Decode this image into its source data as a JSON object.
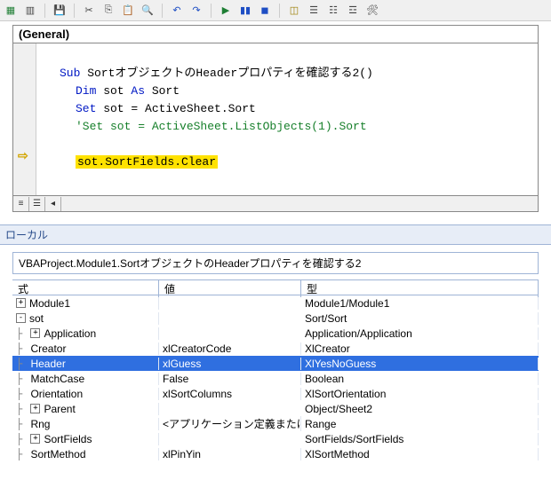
{
  "toolbar": {
    "icons": [
      "xls",
      "sheet",
      "save",
      "cut",
      "copy",
      "paste",
      "find",
      "undo",
      "redo",
      "run",
      "pause",
      "stop",
      "design",
      "proj",
      "props",
      "obj",
      "toolbox",
      "bookmark",
      "help"
    ]
  },
  "code": {
    "dropdown": "(General)",
    "sub_kw": "Sub",
    "sub_name": " SortオブジェクトのHeaderプロパティを確認する2()",
    "dim_kw": "Dim",
    "dim_rest": " sot ",
    "as_kw": "As",
    "dim_type": " Sort",
    "set_kw": "Set",
    "set_rest": " sot = ActiveSheet.Sort",
    "comment": "'Set sot = ActiveSheet.ListObjects(1).Sort",
    "exec_line": "sot.SortFields.Clear"
  },
  "locals": {
    "title": "ローカル",
    "context": "VBAProject.Module1.SortオブジェクトのHeaderプロパティを確認する2",
    "headers": {
      "expr": "式",
      "value": "値",
      "type": "型"
    },
    "rows": [
      {
        "depth": 0,
        "box": "+",
        "name": "Module1",
        "value": "",
        "type": "Module1/Module1",
        "sel": false
      },
      {
        "depth": 0,
        "box": "-",
        "name": "sot",
        "value": "",
        "type": "Sort/Sort",
        "sel": false
      },
      {
        "depth": 1,
        "box": "+",
        "name": "Application",
        "value": "",
        "type": "Application/Application",
        "sel": false
      },
      {
        "depth": 1,
        "box": "",
        "name": "Creator",
        "value": "xlCreatorCode",
        "type": "XlCreator",
        "sel": false
      },
      {
        "depth": 1,
        "box": "",
        "name": "Header",
        "value": "xlGuess",
        "type": "XlYesNoGuess",
        "sel": true
      },
      {
        "depth": 1,
        "box": "",
        "name": "MatchCase",
        "value": "False",
        "type": "Boolean",
        "sel": false
      },
      {
        "depth": 1,
        "box": "",
        "name": "Orientation",
        "value": "xlSortColumns",
        "type": "XlSortOrientation",
        "sel": false
      },
      {
        "depth": 1,
        "box": "+",
        "name": "Parent",
        "value": "",
        "type": "Object/Sheet2",
        "sel": false
      },
      {
        "depth": 1,
        "box": "",
        "name": "Rng",
        "value": "<アプリケーション定義または",
        "type": "Range",
        "sel": false
      },
      {
        "depth": 1,
        "box": "+",
        "name": "SortFields",
        "value": "",
        "type": "SortFields/SortFields",
        "sel": false
      },
      {
        "depth": 1,
        "box": "",
        "name": "SortMethod",
        "value": "xlPinYin",
        "type": "XlSortMethod",
        "sel": false
      }
    ]
  }
}
